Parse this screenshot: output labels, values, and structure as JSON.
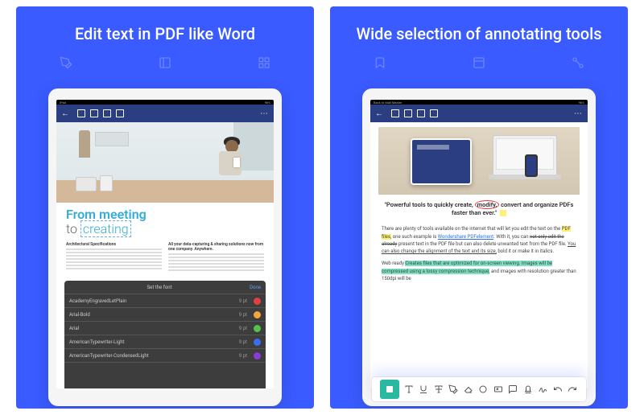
{
  "panel1": {
    "title": "Edit text in PDF like Word",
    "status": {
      "left": "iPad",
      "right": "96%"
    },
    "doc": {
      "headline_top": "From meeting",
      "headline_bottom_prefix": "to ",
      "headline_bottom_edit": "creating",
      "col1_heading": "Architectural Specifications",
      "col2_heading": "All your data-capturing & sharing solutions now from one company. Anywhere."
    },
    "font_panel": {
      "title": "Set the font",
      "done": "Done",
      "rows": [
        {
          "name": "AcademyEngravedLetPlain",
          "size": "9 pt",
          "color": "#e24040"
        },
        {
          "name": "Arial-Bold",
          "size": "9 pt",
          "color": "#f2a63c"
        },
        {
          "name": "Arial",
          "size": "9 pt",
          "color": "#55c24a"
        },
        {
          "name": "AmericanTypewriter-Light",
          "size": "9 pt",
          "color": "#3a6df0"
        },
        {
          "name": "AmericanTypewriter-CondensedLight",
          "size": "9 pt",
          "color": "#8a3ad6"
        }
      ]
    }
  },
  "panel2": {
    "title": "Wide selection of annotating tools",
    "status": {
      "left": "Back to Mail Master",
      "right": "96%"
    },
    "quote": {
      "prefix": "\"Powerful tools to quickly create, ",
      "circled": "modify,",
      "suffix": " convert and organize PDFs faster than ever.\""
    },
    "para": {
      "t1": "There are plenty of tools available on the internet that will let you edit the text on the ",
      "hl1": "PDF files,",
      "t2": " one such example is ",
      "link": "Wondershare PDFelement",
      "t3": ". With it, you can ",
      "strike": "not only edit the already",
      "t4": " present text in the PDF file but can also delete unwanted text from the PDF file. ",
      "ul": "You can also change the alignment of the text and its size,",
      "t5": " bold it or make it in italics.",
      "para2a": "Web ready ",
      "hlg": "Creates files that are optimized for on-screen viewing. Images will be compressed using a lossy compression technique,",
      "para2b": " and images with resolution greater than 150dpi will be"
    }
  }
}
